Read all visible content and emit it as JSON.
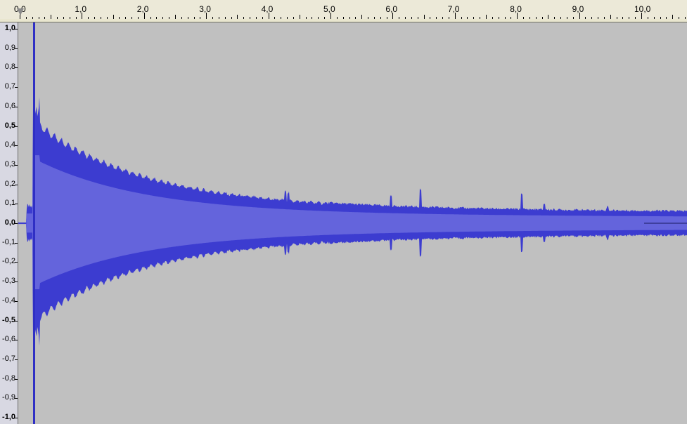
{
  "ruler": {
    "labels": [
      "0,0",
      "1,0",
      "2,0",
      "3,0",
      "4,0",
      "5,0",
      "6,0",
      "7,0",
      "8,0",
      "9,0",
      "10,0"
    ]
  },
  "amplitude": {
    "labels": [
      "1,0",
      "0,9",
      "0,8",
      "0,7",
      "0,6",
      "0,5",
      "0,4",
      "0,3",
      "0,2",
      "0,1",
      "0,0",
      "-0,1",
      "-0,2",
      "-0,3",
      "-0,4",
      "-0,5",
      "-0,6",
      "-0,7",
      "-0,8",
      "-0,9",
      "-1,0"
    ]
  },
  "waveform": {
    "outer_color": "#3c3cd0",
    "inner_color": "#6464dc",
    "background": "#c0c0c0",
    "clip_color": "#2f2fc4"
  }
}
